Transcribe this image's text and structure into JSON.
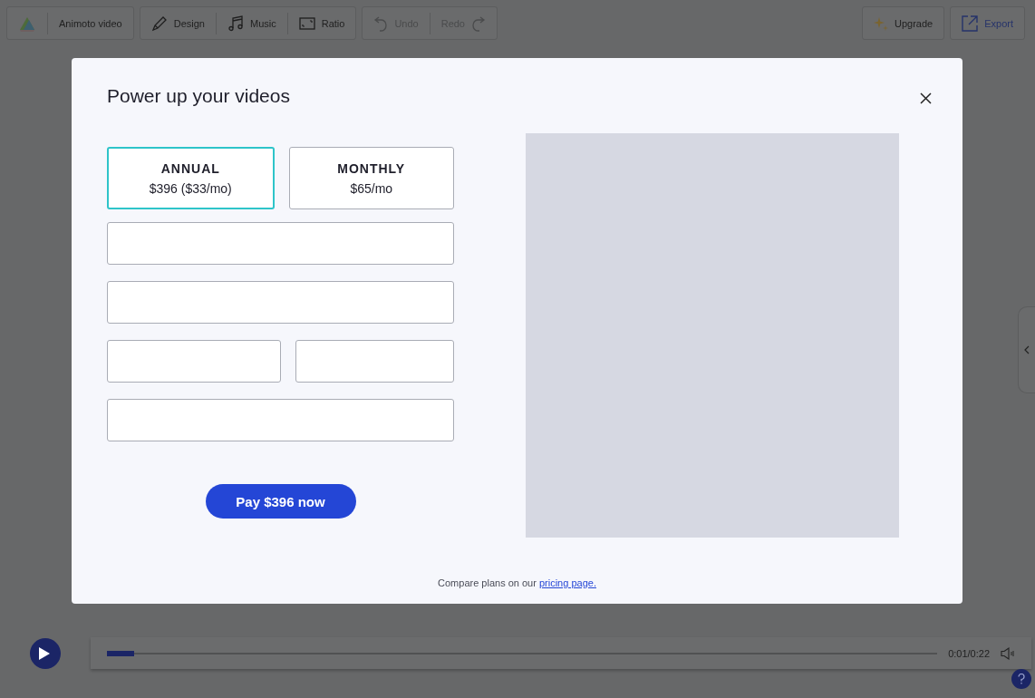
{
  "toolbar": {
    "project": {
      "title": "Animoto video"
    },
    "tools": [
      {
        "kind": "design",
        "label": "Design"
      },
      {
        "kind": "music",
        "label": "Music"
      },
      {
        "kind": "ratio",
        "label": "Ratio"
      }
    ],
    "history": [
      {
        "kind": "undo",
        "label": "Undo",
        "disabled": true
      },
      {
        "kind": "redo",
        "label": "Redo",
        "disabled": true
      }
    ],
    "upgrade": "Upgrade",
    "export": "Export"
  },
  "modal": {
    "title": "Power up your videos",
    "plans": [
      {
        "name": "ANNUAL",
        "price": "$396 ($33/mo)",
        "selected": true
      },
      {
        "name": "MONTHLY",
        "price": "$65/mo",
        "selected": false
      }
    ],
    "fields": [
      {
        "kind": "full"
      },
      {
        "kind": "full"
      },
      {
        "kind": "half"
      },
      {
        "kind": "half"
      },
      {
        "kind": "full"
      }
    ],
    "pay_button": "Pay $396 now",
    "footer": {
      "text": "Compare plans on our",
      "link": "pricing page."
    }
  },
  "player": {
    "level": 0.033,
    "time": "0:01/0:22"
  }
}
